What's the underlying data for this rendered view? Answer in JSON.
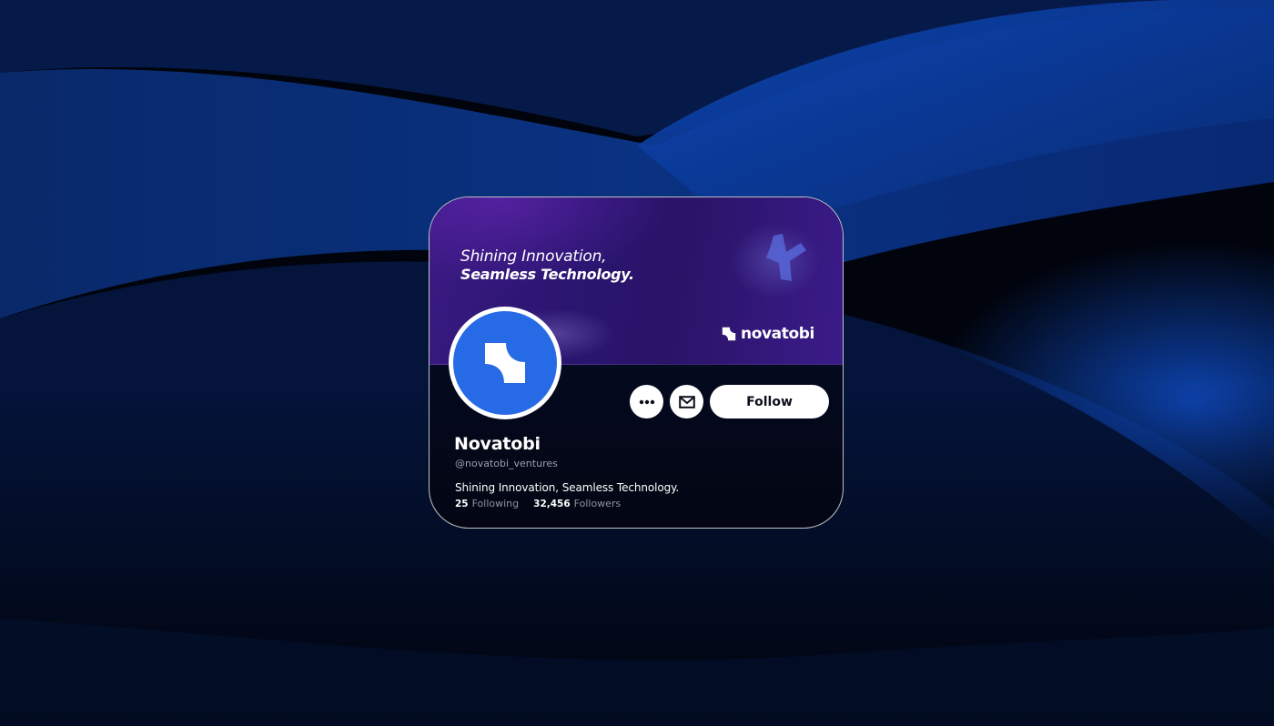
{
  "banner": {
    "tagline_line1": "Shining Innovation,",
    "tagline_line2": "Seamless Technology.",
    "brand_wordmark": "novatobi"
  },
  "profile": {
    "name": "Novatobi",
    "handle": "@novatobi_ventures",
    "bio": "Shining Innovation, Seamless Technology.",
    "following_count": "25",
    "following_label": "Following",
    "followers_count": "32,456",
    "followers_label": "Followers"
  },
  "actions": {
    "more_icon": "more-horizontal-icon",
    "mail_icon": "mail-icon",
    "follow_label": "Follow"
  },
  "colors": {
    "avatar_blue": "#276ae6",
    "banner_purple": "#2a1570",
    "button_bg": "#ffffff"
  }
}
